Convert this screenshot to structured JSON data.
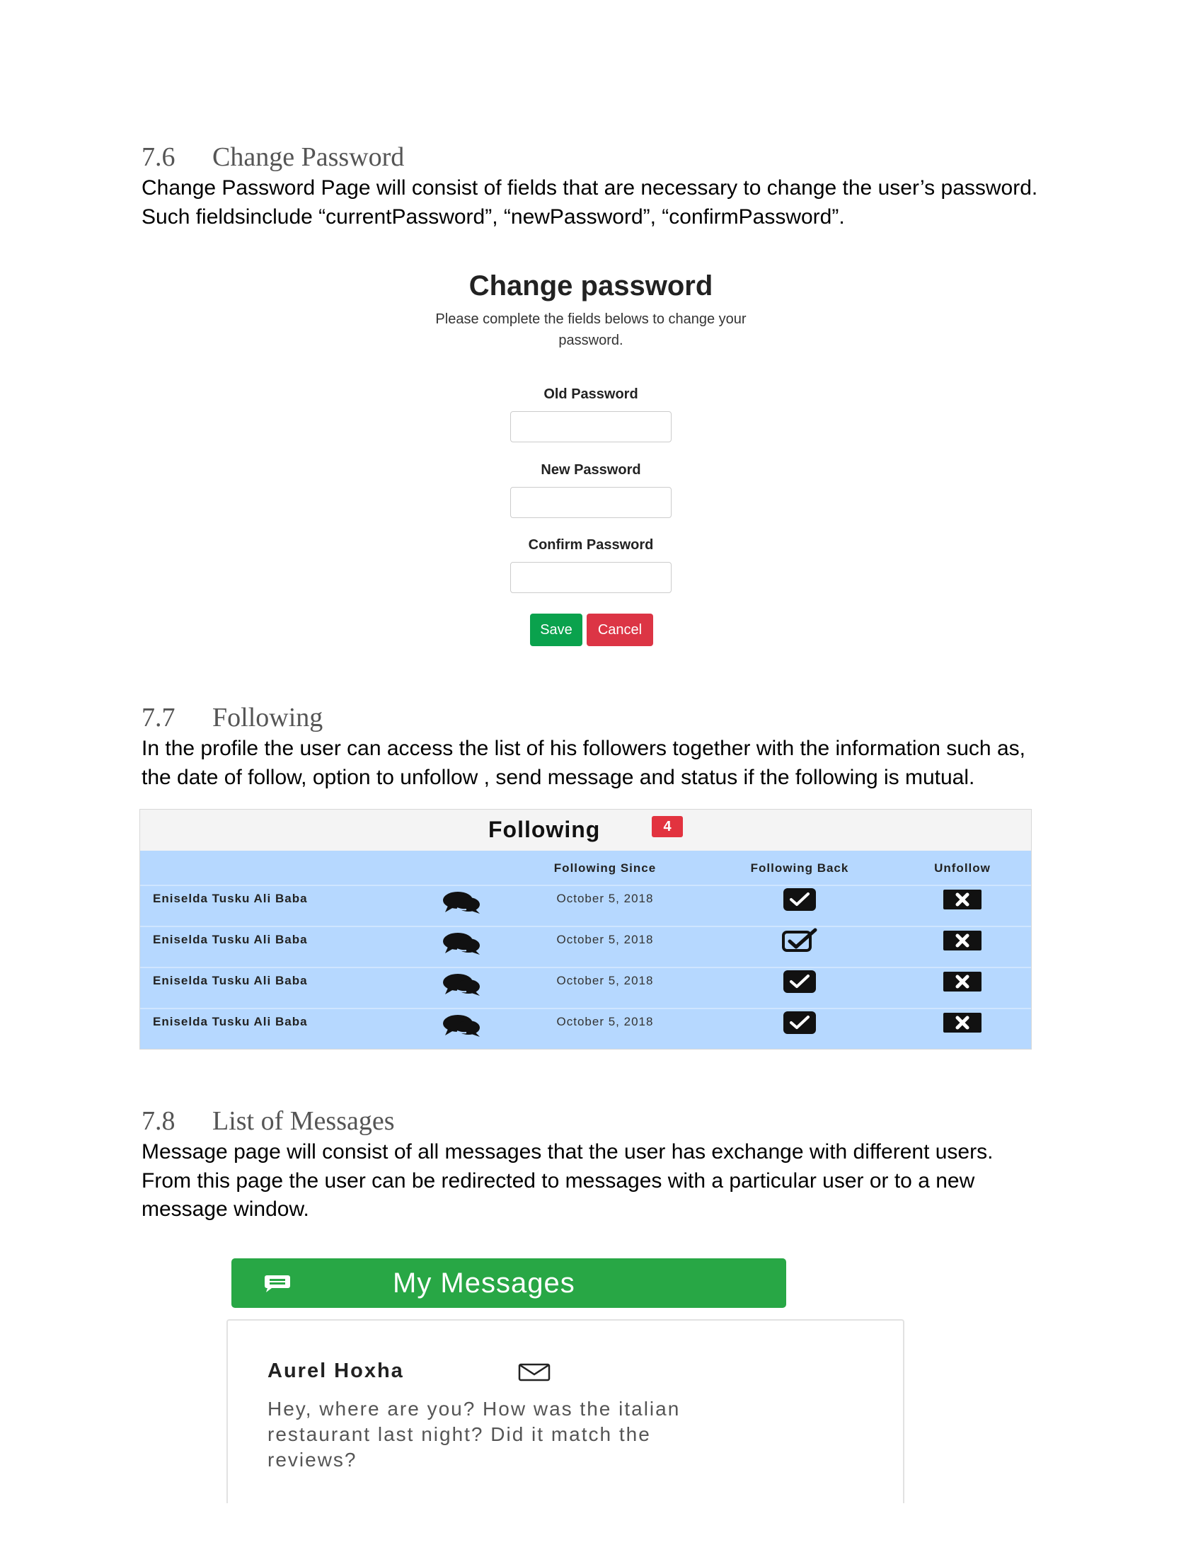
{
  "sections": [
    {
      "number": "7.6",
      "title": "Change Password",
      "body": [
        "Change Password Page will consist of fields that are necessary to change the user’s password.",
        "Such fieldsinclude “currentPassword”, “newPassword”, “confirmPassword”."
      ]
    },
    {
      "number": "7.7",
      "title": "Following",
      "body": [
        "In the profile the user can access the list of his followers together with the information such as,",
        "the date of follow, option to unfollow , send message and status if the following is mutual."
      ]
    },
    {
      "number": "7.8",
      "title": "List of Messages",
      "body": [
        "Message page will consist of all messages that the user has exchange with different users.",
        "From this page the user can be redirected to messages with a particular user or to a new",
        "message window."
      ]
    }
  ],
  "change_password": {
    "title": "Change password",
    "subtitle_line1": "Please complete the fields belows to change your",
    "subtitle_line2": "password.",
    "old_label": "Old Password",
    "new_label": "New Password",
    "confirm_label": "Confirm Password",
    "save_label": "Save",
    "cancel_label": "Cancel",
    "colors": {
      "save": "#0aa24d",
      "cancel": "#dc3545"
    }
  },
  "following": {
    "title": "Following",
    "count": "4",
    "columns": {
      "since": "Following Since",
      "back": "Following Back",
      "unfollow": "Unfollow"
    },
    "rows": [
      {
        "name": "Eniselda Tusku Ali Baba",
        "since": "October 5, 2018",
        "back_icon": "check-square-solid-icon"
      },
      {
        "name": "Eniselda Tusku Ali Baba",
        "since": "October 5, 2018",
        "back_icon": "check-square-outline-icon"
      },
      {
        "name": "Eniselda Tusku Ali Baba",
        "since": "October 5, 2018",
        "back_icon": "check-square-solid-icon"
      },
      {
        "name": "Eniselda Tusku Ali Baba",
        "since": "October 5, 2018",
        "back_icon": "check-square-solid-icon"
      }
    ],
    "colors": {
      "header_bg": "#f4f4f4",
      "row_bg": "#b6d8ff",
      "badge": "#e2333f"
    }
  },
  "messages": {
    "title": "My Messages",
    "items": [
      {
        "name": "Aurel Hoxha",
        "text_line1": "Hey, where are you? How was the italian",
        "text_line2": "restaurant last night? Did it match the",
        "text_line3": "reviews?"
      }
    ],
    "colors": {
      "bar": "#28a745"
    }
  }
}
